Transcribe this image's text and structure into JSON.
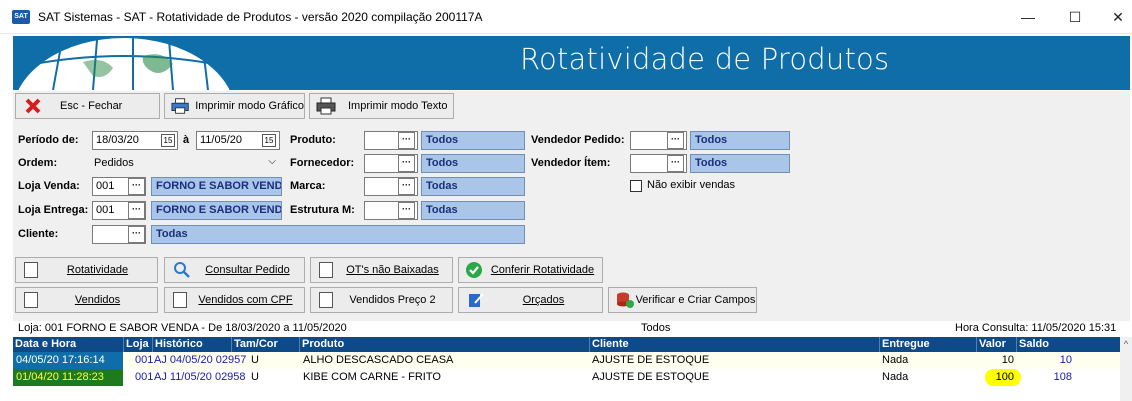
{
  "window": {
    "title": "SAT Sistemas - SAT - Rotatividade de Produtos - versão 2020 compilação 200117A",
    "app_icon_text": "SAT",
    "minimize": "—",
    "maximize": "☐",
    "close": "✕"
  },
  "banner": {
    "title": "Rotatividade de Produtos"
  },
  "toolbar": {
    "close_label": "Esc - Fechar",
    "print_graphic_label": "Imprimir modo Gráfico",
    "print_text_label": "Imprimir modo Texto"
  },
  "filters": {
    "periodo_label": "Período de:",
    "periodo_from": "18/03/20",
    "periodo_sep": "à",
    "periodo_to": "11/05/20",
    "ordem_label": "Ordem:",
    "ordem_value": "Pedidos",
    "loja_venda_label": "Loja Venda:",
    "loja_venda_code": "001",
    "loja_venda_name": "FORNO E SABOR VENDA",
    "loja_entrega_label": "Loja Entrega:",
    "loja_entrega_code": "001",
    "loja_entrega_name": "FORNO E SABOR VENDA",
    "cliente_label": "Cliente:",
    "cliente_value": "Todas",
    "produto_label": "Produto:",
    "produto_value": "Todos",
    "fornecedor_label": "Fornecedor:",
    "fornecedor_value": "Todos",
    "marca_label": "Marca:",
    "marca_value": "Todas",
    "estrutura_label": "Estrutura M:",
    "estrutura_value": "Todas",
    "vendedor_pedido_label": "Vendedor Pedido:",
    "vendedor_pedido_value": "Todos",
    "vendedor_item_label": "Vendedor Ítem:",
    "vendedor_item_value": "Todos",
    "nao_exibir_label": "Não exibir vendas",
    "ellipsis": "···"
  },
  "actions": {
    "rotatividade": "Rotatividade",
    "consultar_pedido": "Consultar Pedido",
    "ots_nao_baixadas": "OT's não Baixadas",
    "conferir_rotatividade": "Conferir Rotatividade",
    "vendidos": "Vendidos",
    "vendidos_cpf": "Vendidos com CPF",
    "vendidos_preco2": "Vendidos Preço 2",
    "orcados": "Orçados",
    "verificar_criar": "Verificar e Criar Campos"
  },
  "results": {
    "info_left": "Loja: 001 FORNO E SABOR VENDA - De 18/03/2020 a 11/05/2020",
    "info_center": "Todos",
    "info_right": "Hora Consulta: 11/05/2020 15:31",
    "columns": [
      "Data e Hora",
      "Loja",
      "Histórico",
      "Tam/Cor",
      "Produto",
      "Cliente",
      "Entregue",
      "Valor",
      "Saldo"
    ],
    "rows": [
      {
        "data": "04/05/20 17:16:14",
        "loja": "001",
        "historico": "AJ 04/05/20 02957",
        "tam": "U",
        "produto": "ALHO DESCASCADO CEASA",
        "cliente": "AJUSTE DE ESTOQUE",
        "entregue": "Nada",
        "valor": "10",
        "saldo": "10"
      },
      {
        "data": "01/04/20 11:28:23",
        "loja": "001",
        "historico": "AJ 11/05/20 02958",
        "tam": "U",
        "produto": "KIBE COM CARNE - FRITO",
        "cliente": "AJUSTE DE ESTOQUE",
        "entregue": "Nada",
        "valor": "100",
        "saldo": "108"
      }
    ]
  },
  "colors": {
    "banner": "#0f6ea8",
    "grid_header": "#0f4a88",
    "lookup_fill": "#a9c5e8",
    "row1_date": "#0f6ea8",
    "row2_date": "#1e7a1e",
    "highlight": "#ffff00"
  }
}
